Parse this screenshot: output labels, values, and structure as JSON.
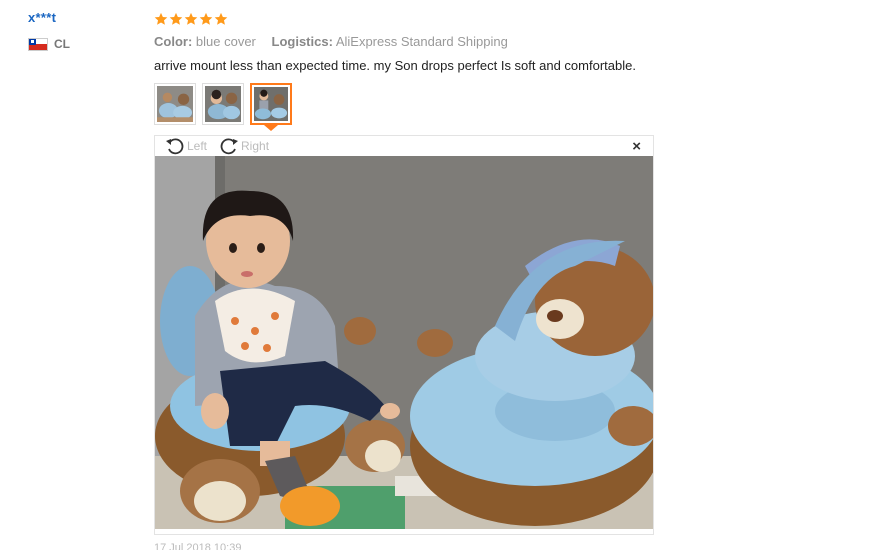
{
  "reviewer": {
    "name": "x***t",
    "country_code": "CL"
  },
  "review": {
    "rating": 5,
    "color_label": "Color:",
    "color_value": "blue cover",
    "logistics_label": "Logistics:",
    "logistics_value": "AliExpress Standard Shipping",
    "text": "arrive mount less than expected time. my Son drops perfect Is soft and comfortable.",
    "thumbnails_count": 3,
    "active_thumbnail": 3,
    "date": "17 Jul 2018 10:39"
  },
  "viewer": {
    "rotate_left_label": "Left",
    "rotate_right_label": "Right",
    "close_label": "×"
  },
  "colors": {
    "star": "#ff9a1a",
    "accent": "#ff7a1a",
    "link": "#1a66c2"
  }
}
